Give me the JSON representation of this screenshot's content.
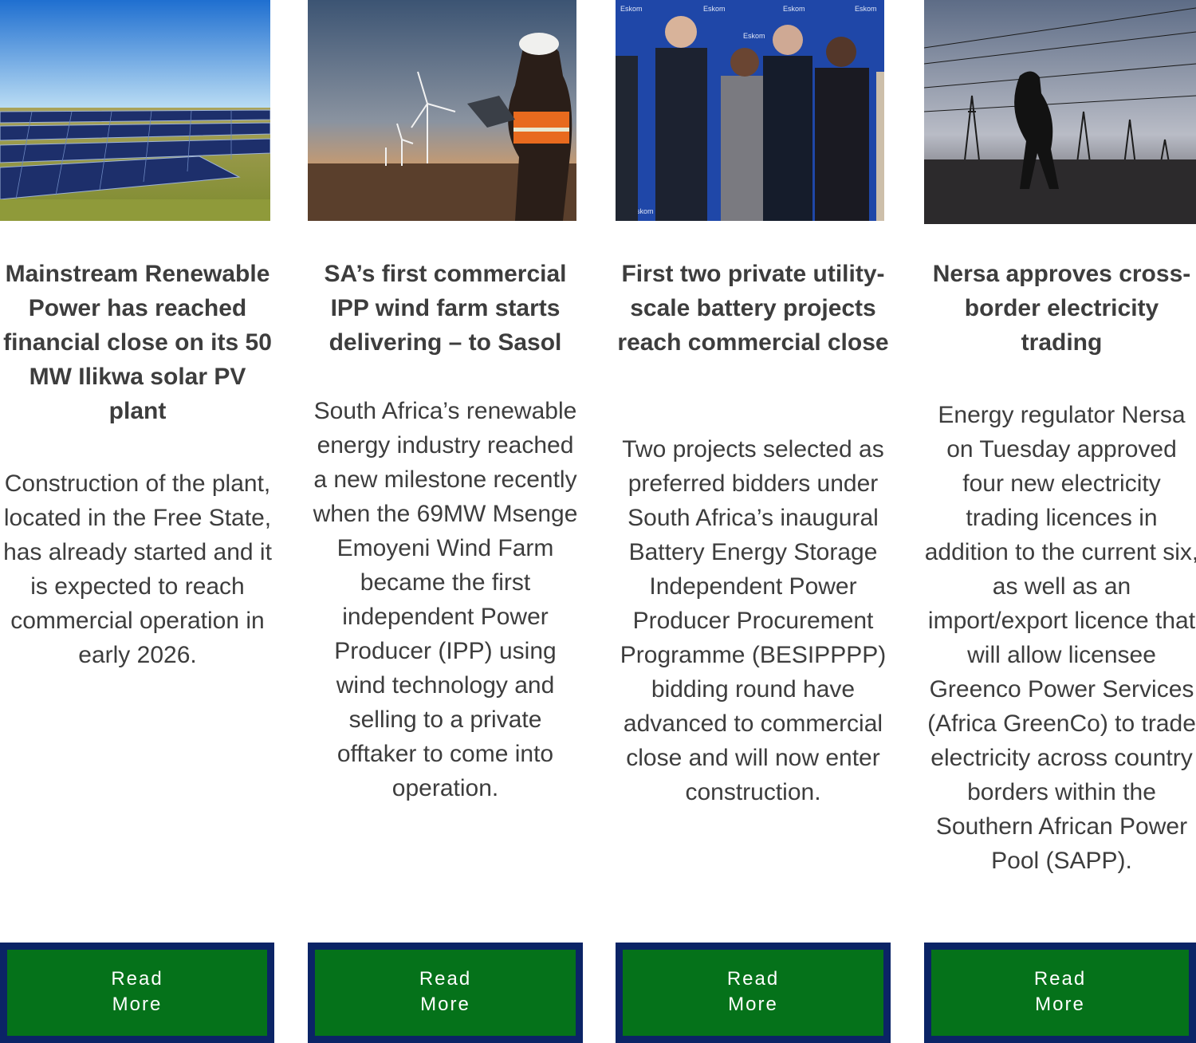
{
  "articles": [
    {
      "image_alt": "Solar panel field under blue sky",
      "title": "Mainstream Renewable Power has reached financial close on its 50 MW Ilikwa solar PV plant",
      "body": "Construction of the plant, located in the Free State, has already started and it is expected to reach commercial operation in early 2026.",
      "button_line1": "Read",
      "button_line2": "More"
    },
    {
      "image_alt": "Engineer with laptop at wind farm at dusk",
      "title": "SA’s first commercial IPP wind farm starts delivering – to Sasol",
      "body": "South Africa’s renewable energy industry reached a new milestone recently when the 69MW Msenge Emoyeni Wind Farm became the first independent Power Producer (IPP) using wind technology and selling to a private offtaker to come into operation.",
      "button_line1": "Read",
      "button_line2": "More"
    },
    {
      "image_alt": "Group of executives in front of Eskom backdrop",
      "backdrop_text": "Eskom",
      "title": "First two private utility-scale battery projects reach commercial close",
      "body": "Two projects selected as preferred bidders under South Africa’s inaugural Battery Energy Storage Independent Power Producer Procurement Programme (BESIPPPP) bidding round have advanced to commercial close and will now enter construction.",
      "button_line1": "Read",
      "button_line2": "More"
    },
    {
      "image_alt": "Silhouette walking under power lines",
      "title": "Nersa approves cross-border electricity trading",
      "body": "Energy regulator Nersa on Tuesday approved four new electricity trading licences in addition to the current six, as well as an import/export licence that will allow licensee Greenco Power Services (Africa GreenCo) to trade electricity across country borders within the Southern African Power Pool (SAPP).",
      "button_line1": "Read",
      "button_line2": "More"
    }
  ],
  "colors": {
    "button_border": "#0b2466",
    "button_fill": "#05721a",
    "button_text": "#ffffff",
    "text": "#3d3d3d"
  }
}
